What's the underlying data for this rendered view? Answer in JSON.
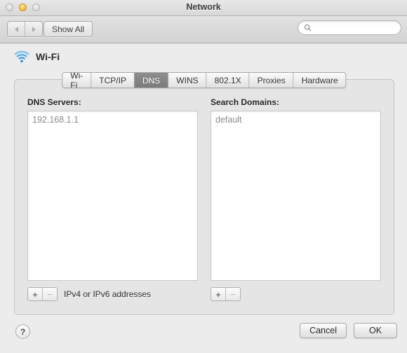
{
  "window": {
    "title": "Network",
    "traffic_lights": [
      {
        "name": "close",
        "state": "inactive"
      },
      {
        "name": "minimize",
        "state": "active",
        "color": "#f7c44c"
      },
      {
        "name": "zoom",
        "state": "inactive"
      }
    ]
  },
  "toolbar": {
    "back_label": "Back",
    "forward_label": "Forward",
    "show_all_label": "Show All",
    "search": {
      "icon": "search-icon",
      "value": "",
      "placeholder": ""
    }
  },
  "service": {
    "icon": "wifi-icon",
    "name": "Wi-Fi",
    "accent_color": "#3d9ae0"
  },
  "tabs": [
    {
      "label": "Wi-Fi",
      "selected": false
    },
    {
      "label": "TCP/IP",
      "selected": false
    },
    {
      "label": "DNS",
      "selected": true
    },
    {
      "label": "WINS",
      "selected": false
    },
    {
      "label": "802.1X",
      "selected": false
    },
    {
      "label": "Proxies",
      "selected": false
    },
    {
      "label": "Hardware",
      "selected": false
    }
  ],
  "dns_panel": {
    "servers": {
      "label": "DNS Servers:",
      "entries": [
        "192.168.1.1"
      ],
      "add_label": "+",
      "remove_label": "−",
      "remove_enabled": false,
      "hint": "IPv4 or IPv6 addresses"
    },
    "search_domains": {
      "label": "Search Domains:",
      "entries": [
        "default"
      ],
      "add_label": "+",
      "remove_label": "−",
      "remove_enabled": false,
      "hint": ""
    }
  },
  "footer": {
    "help_label": "?",
    "cancel_label": "Cancel",
    "ok_label": "OK"
  }
}
